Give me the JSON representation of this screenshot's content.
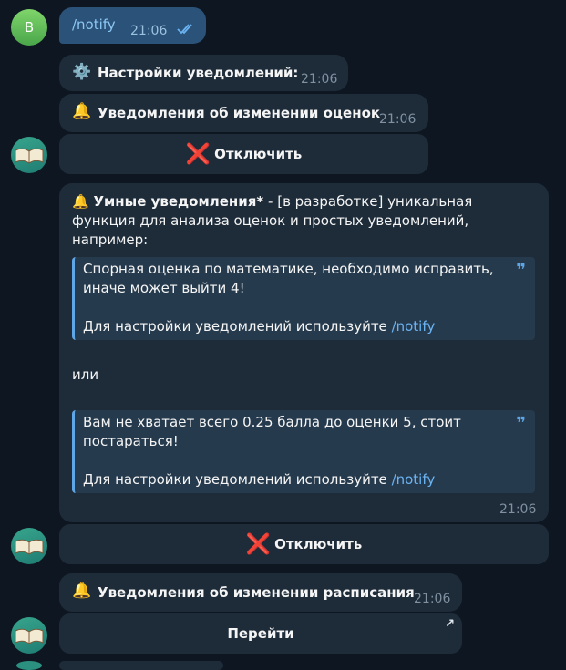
{
  "user": {
    "avatar_letter": "B"
  },
  "outgoing": {
    "text": "/notify",
    "time": "21:06"
  },
  "settings_msg": {
    "icon": "⚙️",
    "text": "Настройки уведомлений:",
    "time": "21:06"
  },
  "grades_msg": {
    "icon": "🔔",
    "text": "Уведомления об изменении оценок",
    "time": "21:06"
  },
  "grades_button": {
    "icon": "❌",
    "label": "Отключить"
  },
  "smart_msg": {
    "icon": "🔔",
    "title": "Умные уведомления*",
    "text": " - [в разработке] уникальная функция для анализа оценок и простых уведомлений, например:",
    "quote1_line1": "Спорная оценка по математике, необходимо исправить, иначе может выйти 4!",
    "quote_prefix": "Для настройки уведомлений используйте ",
    "quote_link": "/notify",
    "or_text": "или",
    "quote2_line1": "Вам не хватает всего 0.25 балла до оценки 5, стоит постараться!",
    "time": "21:06"
  },
  "smart_button": {
    "icon": "❌",
    "label": "Отключить"
  },
  "schedule_msg": {
    "icon": "🔔",
    "text": "Уведомления об изменении расписания",
    "time": "21:06"
  },
  "schedule_button": {
    "label": "Перейти",
    "arrow": "↗"
  }
}
